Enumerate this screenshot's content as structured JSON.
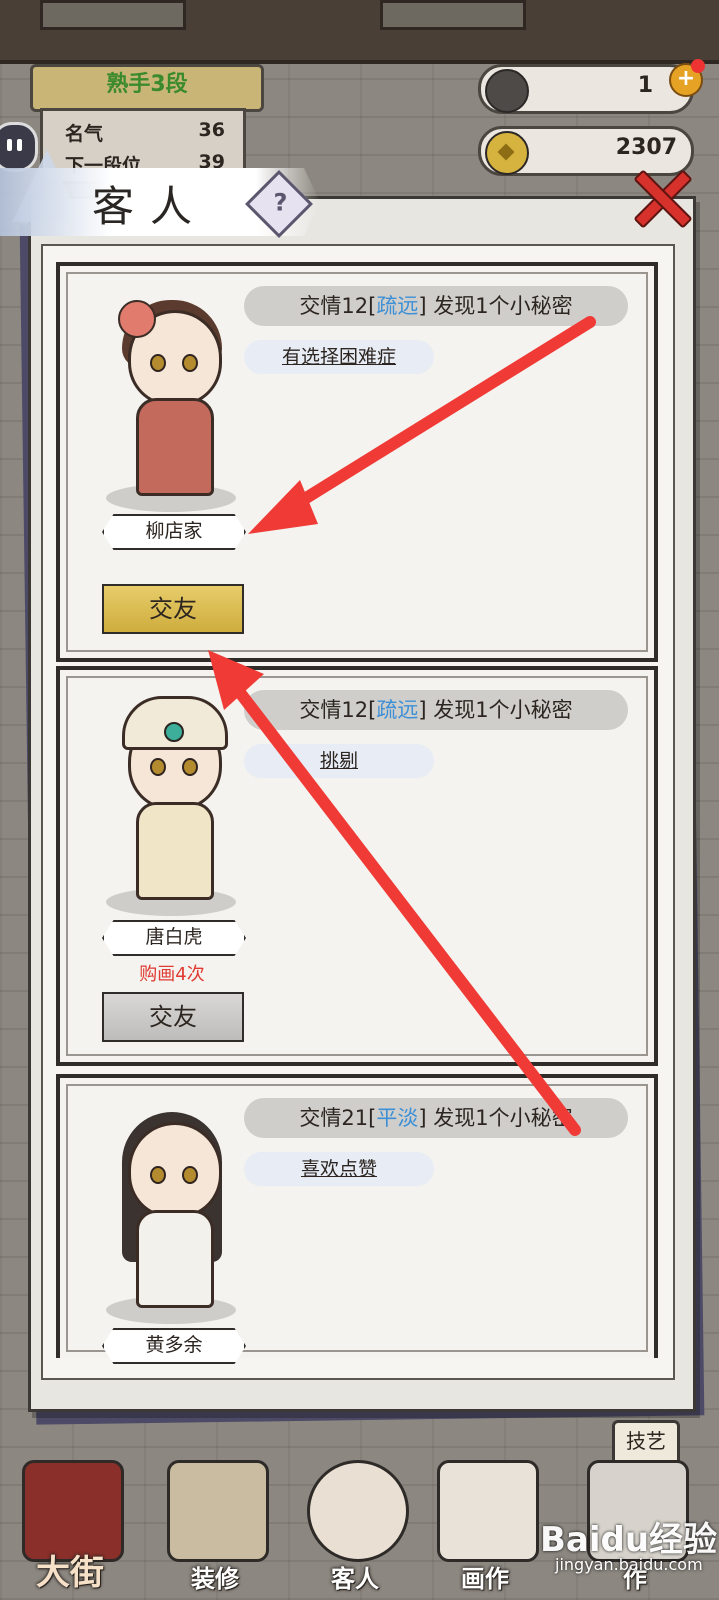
{
  "hud": {
    "rank_title": "熟手3段",
    "fame_label": "名气",
    "fame_value": "36",
    "next_rank_label": "下一段位",
    "next_rank_value": "39",
    "jade_count": "1",
    "coin_count": "2307",
    "plus_symbol": "+"
  },
  "panel": {
    "title": "客人",
    "help_symbol": "?"
  },
  "guests": [
    {
      "friendship": "交情12",
      "relation": "疏远",
      "secret": "发现1个小秘密",
      "trait": "有选择困难症",
      "name": "柳店家",
      "purchase": "",
      "button": "交友",
      "button_state": "active"
    },
    {
      "friendship": "交情12",
      "relation": "疏远",
      "secret": "发现1个小秘密",
      "trait": "挑剔",
      "name": "唐白虎",
      "purchase": "购画4次",
      "button": "交友",
      "button_state": "disabled"
    },
    {
      "friendship": "交情21",
      "relation": "平淡",
      "secret": "发现1个小秘密",
      "trait": "喜欢点赞",
      "name": "黄多余",
      "purchase": "",
      "button": "",
      "button_state": ""
    }
  ],
  "nav": {
    "skill_tag": "技艺",
    "items": [
      "大街",
      "装修",
      "客人",
      "画作",
      "作"
    ]
  },
  "watermark": {
    "logo": "Baidu经验",
    "url": "jingyan.baidu.com"
  },
  "colors": {
    "relation_blue": "#3d8fd6",
    "purchase_red": "#e03a32",
    "arrow_red": "#f03a36",
    "active_button": "#d9bb50"
  }
}
